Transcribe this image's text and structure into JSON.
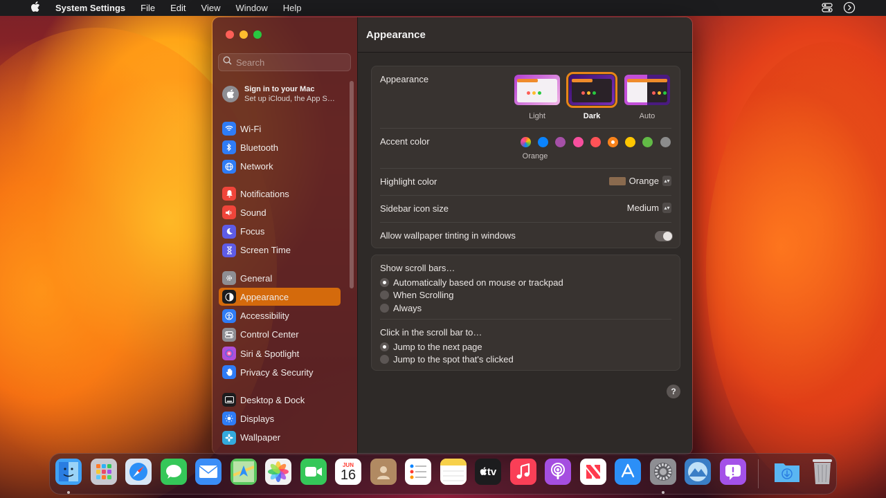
{
  "menubar": {
    "app_name": "System Settings",
    "items": [
      "File",
      "Edit",
      "View",
      "Window",
      "Help"
    ]
  },
  "sidebar": {
    "search_placeholder": "Search",
    "signin": {
      "title": "Sign in to your Mac",
      "subtitle": "Set up iCloud, the App S…"
    },
    "groups": [
      [
        {
          "label": "Wi-Fi",
          "icon": "wifi-icon",
          "color": "#2f7cf6"
        },
        {
          "label": "Bluetooth",
          "icon": "bluetooth-icon",
          "color": "#2f7cf6"
        },
        {
          "label": "Network",
          "icon": "globe-icon",
          "color": "#2f7cf6"
        }
      ],
      [
        {
          "label": "Notifications",
          "icon": "bell-icon",
          "color": "#f0453a"
        },
        {
          "label": "Sound",
          "icon": "speaker-icon",
          "color": "#f0453a"
        },
        {
          "label": "Focus",
          "icon": "moon-icon",
          "color": "#5e5ce6"
        },
        {
          "label": "Screen Time",
          "icon": "hourglass-icon",
          "color": "#5e5ce6"
        }
      ],
      [
        {
          "label": "General",
          "icon": "gear-icon",
          "color": "#8e8e93"
        },
        {
          "label": "Appearance",
          "icon": "appearance-icon",
          "color": "#1c1c1e",
          "active": true
        },
        {
          "label": "Accessibility",
          "icon": "accessibility-icon",
          "color": "#2f7cf6"
        },
        {
          "label": "Control Center",
          "icon": "control-center-icon",
          "color": "#8e8e93"
        },
        {
          "label": "Siri & Spotlight",
          "icon": "siri-icon",
          "color": "#b04fd8"
        },
        {
          "label": "Privacy & Security",
          "icon": "hand-icon",
          "color": "#2f7cf6"
        }
      ],
      [
        {
          "label": "Desktop & Dock",
          "icon": "dock-icon",
          "color": "#1c1c1e"
        },
        {
          "label": "Displays",
          "icon": "sun-icon",
          "color": "#2f7cf6"
        },
        {
          "label": "Wallpaper",
          "icon": "flower-icon",
          "color": "#34aadc"
        }
      ]
    ]
  },
  "content": {
    "title": "Appearance",
    "appearance": {
      "label": "Appearance",
      "options": [
        {
          "label": "Light",
          "selected": false
        },
        {
          "label": "Dark",
          "selected": true
        },
        {
          "label": "Auto",
          "selected": false
        }
      ]
    },
    "accent": {
      "label": "Accent color",
      "selected_label": "Orange",
      "colors": [
        "multicolor",
        "#0a84ff",
        "#a550a7",
        "#f74f9e",
        "#ff5257",
        "#f7821b",
        "#ffc600",
        "#62ba46",
        "#8c8c8c"
      ],
      "selected_index": 5
    },
    "highlight": {
      "label": "Highlight color",
      "value": "Orange",
      "swatch": "#8a6a4e"
    },
    "sidebar_icon_size": {
      "label": "Sidebar icon size",
      "value": "Medium"
    },
    "wallpaper_tinting": {
      "label": "Allow wallpaper tinting in windows",
      "on": false
    },
    "scroll_bars": {
      "label": "Show scroll bars…",
      "options": [
        {
          "label": "Automatically based on mouse or trackpad",
          "selected": true
        },
        {
          "label": "When Scrolling",
          "selected": false
        },
        {
          "label": "Always",
          "selected": false
        }
      ]
    },
    "click_scroll": {
      "label": "Click in the scroll bar to…",
      "options": [
        {
          "label": "Jump to the next page",
          "selected": true
        },
        {
          "label": "Jump to the spot that's clicked",
          "selected": false
        }
      ]
    },
    "help": "?"
  },
  "dock": {
    "calendar_month": "JUN",
    "calendar_day": "16",
    "tv_label": "tv",
    "apps": [
      {
        "name": "finder",
        "color": "#3fa1f5",
        "running": true
      },
      {
        "name": "launchpad",
        "color": "#c9c9d0",
        "running": false
      },
      {
        "name": "safari",
        "color": "#d8e6f5",
        "running": false
      },
      {
        "name": "messages",
        "color": "#35c759",
        "running": false
      },
      {
        "name": "mail",
        "color": "#3a8df7",
        "running": false
      },
      {
        "name": "maps",
        "color": "#5ac75e",
        "running": false
      },
      {
        "name": "photos",
        "color": "#f2f2f2",
        "running": false
      },
      {
        "name": "facetime",
        "color": "#35c759",
        "running": false
      },
      {
        "name": "calendar",
        "color": "#ffffff",
        "running": false
      },
      {
        "name": "contacts",
        "color": "#b18a62",
        "running": false
      },
      {
        "name": "reminders",
        "color": "#ffffff",
        "running": false
      },
      {
        "name": "notes",
        "color": "#f7e37b",
        "running": false
      },
      {
        "name": "tv",
        "color": "#1c1c1e",
        "running": false
      },
      {
        "name": "music",
        "color": "#fa3f57",
        "running": false
      },
      {
        "name": "podcasts",
        "color": "#a54ee0",
        "running": false
      },
      {
        "name": "news",
        "color": "#ffffff",
        "running": false
      },
      {
        "name": "app-store",
        "color": "#2c8ff7",
        "running": false
      },
      {
        "name": "system-settings",
        "color": "#8e8e93",
        "running": true
      },
      {
        "name": "mountain-app",
        "color": "#3a7ec6",
        "running": false
      },
      {
        "name": "feedback",
        "color": "#a452e8",
        "running": false
      },
      {
        "name": "downloads",
        "color": "#4aa3e8",
        "running": false
      },
      {
        "name": "trash",
        "color": "#b8b8bc",
        "running": false
      }
    ]
  }
}
